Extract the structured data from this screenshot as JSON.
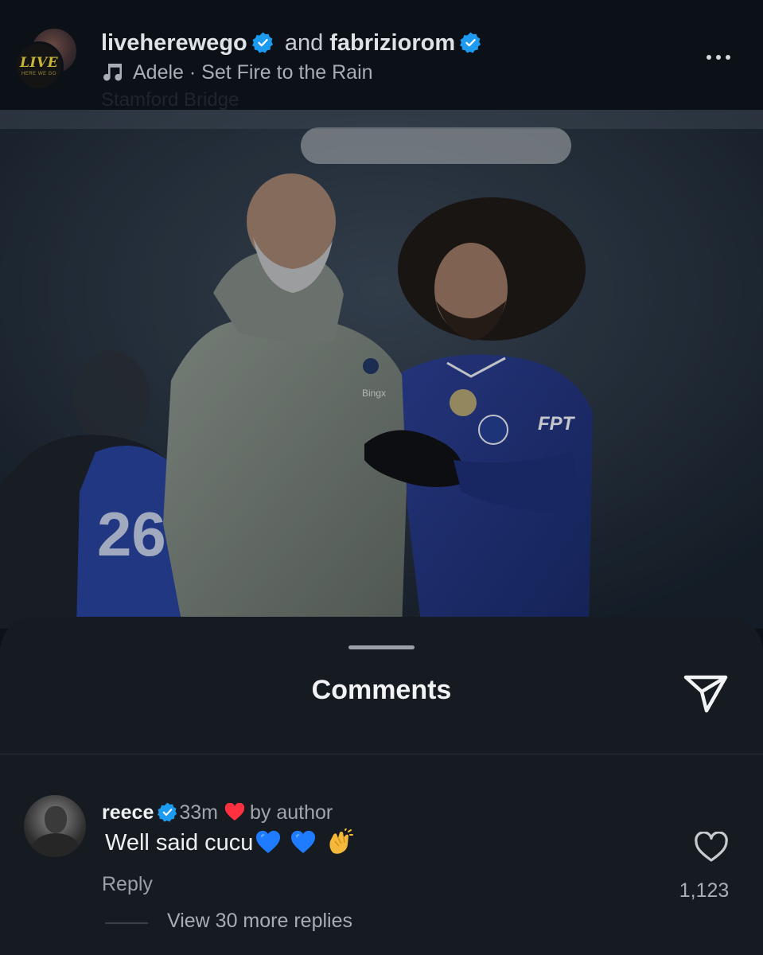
{
  "post": {
    "author_1": "liveherewego",
    "connector": "and",
    "author_2": "fabriziorom",
    "music_artist_track": "Adele · Set Fire to the Rain",
    "faded_location": "Stamford Bridge",
    "avatar_logo_text": "LIVE",
    "avatar_logo_subtext": "HERE WE GO"
  },
  "photo": {
    "left_kit_number": "26",
    "jersey_sponsor": "FPT",
    "coat_sponsor": "Bingx"
  },
  "comments_sheet": {
    "title": "Comments"
  },
  "comment": {
    "username": "reece",
    "time": "33m",
    "liked_label": "by author",
    "text": "Well said cucu",
    "reply_label": "Reply",
    "like_count": "1,123",
    "view_replies": "View 30 more replies"
  },
  "colors": {
    "verified_blue": "#1d9bf0",
    "heart_red": "#ff3040",
    "emoji_heart_blue": "#1f7bff"
  },
  "icons": [
    "music-note-icon",
    "verified-badge-icon",
    "more-options-icon",
    "share-send-icon",
    "heart-icon",
    "red-heart-icon",
    "blue-heart-emoji",
    "clap-emoji"
  ]
}
